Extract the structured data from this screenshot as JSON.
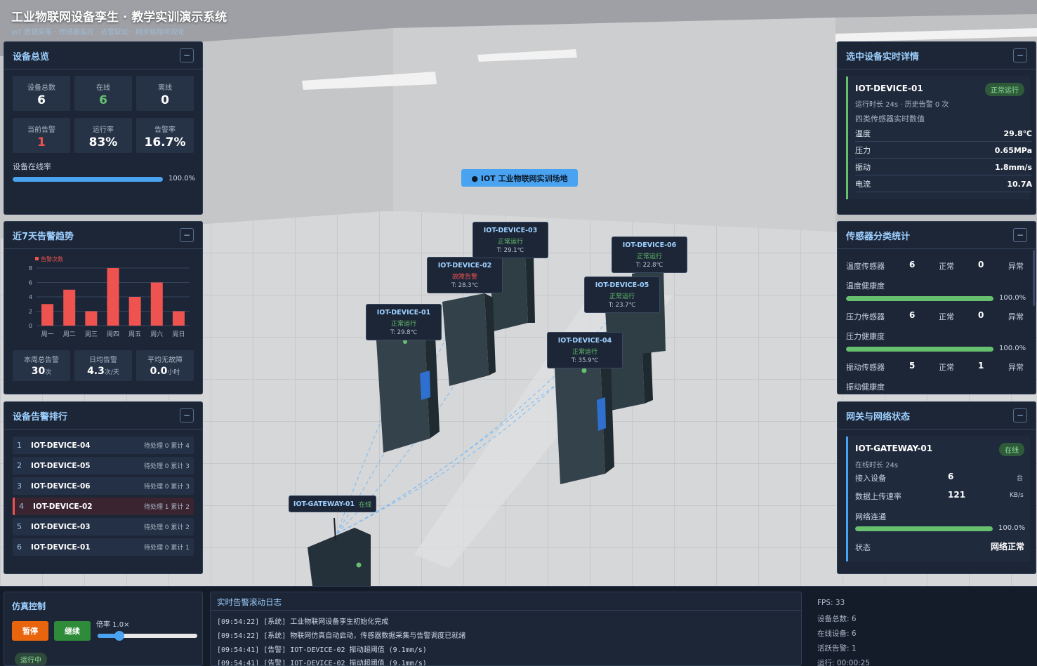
{
  "header": {
    "title": "工业物联网设备孪生 · 教学实训演示系统",
    "subtitle": "IoT 数据采集 · 传感器监控 · 告警联动 · 网关链路可视化"
  },
  "site_label": "● IOT 工业物联网实训场地",
  "overview": {
    "title": "设备总览",
    "collapse": "−",
    "stats": [
      {
        "label": "设备总数",
        "value": "6",
        "color": "#ffffff"
      },
      {
        "label": "在线",
        "value": "6",
        "color": "#67c06e"
      },
      {
        "label": "离线",
        "value": "0",
        "color": "#ffffff"
      },
      {
        "label": "当前告警",
        "value": "1",
        "color": "#ef5350"
      },
      {
        "label": "运行率",
        "value": "83%",
        "color": "#ffffff"
      },
      {
        "label": "告警率",
        "value": "16.7%",
        "color": "#ffffff"
      }
    ],
    "online_label": "设备在线率",
    "online_pct": 1.0,
    "online_text": "100.0%"
  },
  "trend": {
    "title": "近7天告警趋势",
    "collapse": "−",
    "chart_data": {
      "type": "bar",
      "categories": [
        "周一",
        "周二",
        "周三",
        "周四",
        "周五",
        "周六",
        "周日"
      ],
      "series": [
        {
          "name": "告警次数",
          "values": [
            3,
            5,
            2,
            8,
            4,
            6,
            2
          ]
        }
      ],
      "yticks": [
        "0",
        "2",
        "4",
        "6",
        "8"
      ],
      "ylim": [
        0,
        8
      ]
    },
    "stats": [
      {
        "label": "本周总告警",
        "value": "30",
        "unit": "次"
      },
      {
        "label": "日均告警",
        "value": "4.3",
        "unit": "次/天"
      },
      {
        "label": "平均无故障",
        "value": "0.0",
        "unit": "小时"
      }
    ]
  },
  "ranking": {
    "title": "设备告警排行",
    "collapse": "−",
    "rows": [
      {
        "n": "1",
        "device": "IOT-DEVICE-04",
        "pending": "待处理 0",
        "total": "累计 4"
      },
      {
        "n": "2",
        "device": "IOT-DEVICE-05",
        "pending": "待处理 0",
        "total": "累计 3"
      },
      {
        "n": "3",
        "device": "IOT-DEVICE-06",
        "pending": "待处理 0",
        "total": "累计 3"
      },
      {
        "n": "4",
        "device": "IOT-DEVICE-02",
        "pending": "待处理 1",
        "total": "累计 2"
      },
      {
        "n": "5",
        "device": "IOT-DEVICE-03",
        "pending": "待处理 0",
        "total": "累计 2"
      },
      {
        "n": "6",
        "device": "IOT-DEVICE-01",
        "pending": "待处理 0",
        "total": "累计 1"
      }
    ]
  },
  "detail": {
    "title": "选中设备实时详情",
    "collapse": "−",
    "device": "IOT-DEVICE-01",
    "status": "正常运行",
    "runtime": "运行时长 24s · 历史告警 0 次",
    "section": "四类传感器实时数值",
    "rows": [
      {
        "k": "温度",
        "v": "29.8℃"
      },
      {
        "k": "压力",
        "v": "0.65MPa"
      },
      {
        "k": "振动",
        "v": "1.8mm/s"
      },
      {
        "k": "电流",
        "v": "10.7A"
      }
    ]
  },
  "sensors": {
    "title": "传感器分类统计",
    "collapse": "−",
    "groups": [
      {
        "name": "温度传感器",
        "ok": "6",
        "ok_label": "正常",
        "bad": "0",
        "bad_label": "异常",
        "health_label": "温度健康度",
        "health": 1.0,
        "health_text": "100.0%"
      },
      {
        "name": "压力传感器",
        "ok": "6",
        "ok_label": "正常",
        "bad": "0",
        "bad_label": "异常",
        "health_label": "压力健康度",
        "health": 1.0,
        "health_text": "100.0%"
      },
      {
        "name": "振动传感器",
        "ok": "5",
        "ok_label": "正常",
        "bad": "1",
        "bad_label": "异常",
        "health_label": "振动健康度"
      }
    ]
  },
  "gateway": {
    "title": "网关与网络状态",
    "collapse": "−",
    "name": "IOT-GATEWAY-01",
    "status": "在线",
    "uptime": "在线时长 24s",
    "devices_label": "接入设备",
    "devices": "6",
    "devices_unit": "台",
    "rate_label": "数据上传速率",
    "rate": "121",
    "rate_unit": "KB/s",
    "conn_label": "网络连通",
    "conn": 1.0,
    "conn_text": "100.0%",
    "state_label": "状态",
    "state": "网络正常"
  },
  "control": {
    "title": "仿真控制",
    "pause": "暂停",
    "resume": "继续",
    "speed_label": "倍率 1.0×",
    "speed": 0.22,
    "running": "运行中"
  },
  "alarm_log": {
    "title": "实时告警滚动日志",
    "lines": [
      "[09:54:22]  [系统] 工业物联网设备孪生初始化完成",
      "[09:54:22]  [系统] 物联网仿真自动启动，传感器数据采集与告警调度已就绪",
      "[09:54:41]  [告警] IOT-DEVICE-02 振动超阈值 (9.1mm/s)",
      "[09:54:41]  [告警] IOT-DEVICE-02 振动超阈值 (9.1mm/s)"
    ]
  },
  "sysinfo": {
    "lines": [
      "FPS: 33",
      "设备总数: 6",
      "在线设备: 6",
      "活跃告警: 1",
      "运行: 00:00:25"
    ]
  },
  "devices3d": [
    {
      "name": "IOT-DEVICE-01",
      "status": "正常运行",
      "temp": "T: 29.8℃",
      "color": "#67c06e"
    },
    {
      "name": "IOT-DEVICE-02",
      "status": "故障告警",
      "temp": "T: 28.3℃",
      "color": "#ef5350"
    },
    {
      "name": "IOT-DEVICE-03",
      "status": "正常运行",
      "temp": "T: 29.1℃",
      "color": "#67c06e"
    },
    {
      "name": "IOT-DEVICE-04",
      "status": "正常运行",
      "temp": "T: 35.9℃",
      "color": "#67c06e"
    },
    {
      "name": "IOT-DEVICE-05",
      "status": "正常运行",
      "temp": "T: 23.7℃",
      "color": "#67c06e"
    },
    {
      "name": "IOT-DEVICE-06",
      "status": "正常运行",
      "temp": "T: 22.8℃",
      "color": "#67c06e"
    }
  ],
  "gateway3d": {
    "name": "IOT-GATEWAY-01",
    "status": "在线"
  },
  "colors": {
    "accent": "#4aa3f0",
    "ok": "#67c06e",
    "alarm": "#ef5350",
    "panel": "#1c2637"
  }
}
